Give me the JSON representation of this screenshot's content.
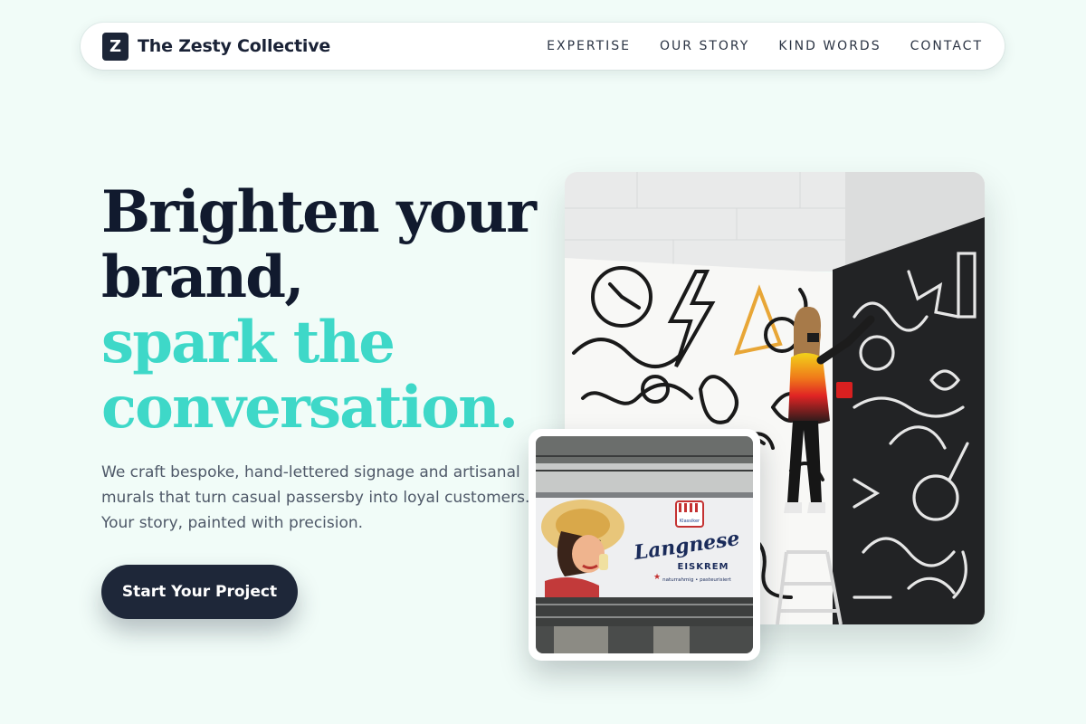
{
  "brand": {
    "logo_letter": "Z",
    "name": "The Zesty Collective"
  },
  "nav": {
    "items": [
      {
        "label": "EXPERTISE"
      },
      {
        "label": "OUR STORY"
      },
      {
        "label": "KIND WORDS"
      },
      {
        "label": "CONTACT"
      }
    ]
  },
  "hero": {
    "title_lines": [
      {
        "text": "Brighten your",
        "style": "dark"
      },
      {
        "text": "brand,",
        "style": "dark"
      },
      {
        "text": "spark the",
        "style": "accent"
      },
      {
        "text": "conversation.",
        "style": "accent"
      }
    ],
    "body": "We craft bespoke, hand-lettered signage and artisanal murals that turn casual passersby into loyal customers. Your story, painted with precision.",
    "cta_label": "Start Your Project"
  },
  "media": {
    "main_photo_icon": "mural-artist-photo",
    "inset_photo_icon": "vintage-billboard-photo",
    "inset_sign": {
      "badge": "Klassiker",
      "brand": "Langnese",
      "product": "EISKREM",
      "tagline": "naturrahmig • pasteurisiert"
    }
  },
  "colors": {
    "background": "#f1fcf8",
    "navy": "#1e2739",
    "accent": "#3ed8c8",
    "body_text": "#4e5868"
  }
}
